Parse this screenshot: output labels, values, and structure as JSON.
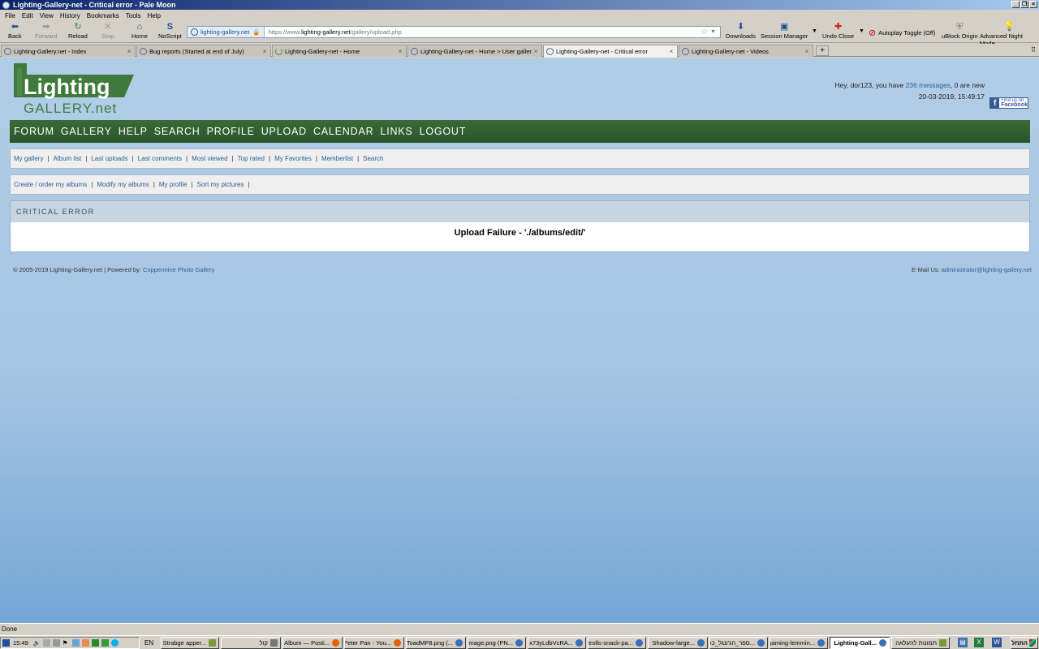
{
  "window": {
    "title": "Lighting-Gallery-net - Critical error - Pale Moon",
    "controls": [
      "_",
      "❐",
      "×"
    ]
  },
  "menu": [
    "File",
    "Edit",
    "View",
    "History",
    "Bookmarks",
    "Tools",
    "Help"
  ],
  "toolbar": {
    "back": "Back",
    "forward": "Forward",
    "reload": "Reload",
    "stop": "Stop",
    "home": "Home",
    "noscript": "NoScript",
    "site_identity": "lighting-gallery.net",
    "url_prefix": "https://www.",
    "url_domain": "lighting-gallery.net",
    "url_path": "/gallery/upload.php",
    "downloads": "Downloads",
    "session_manager": "Session Manager",
    "undo_close": "Undo Close",
    "autoplay_toggle": "Autoplay Toggle (Off)",
    "ublock": "uBlock Origin",
    "night_mode": "Advanced Night Mode"
  },
  "tabs": [
    {
      "label": "Lighting-Gallery.net - Index",
      "active": false
    },
    {
      "label": "Bug reports (Started at end of July)",
      "active": false
    },
    {
      "label": "Lighting-Gallery-net - Home",
      "active": false
    },
    {
      "label": "Lighting-Gallery-net - Home > User galler…",
      "active": false
    },
    {
      "label": "Lighting-Gallery-net - Critical error",
      "active": true
    },
    {
      "label": "Lighting-Gallery-net - Videos",
      "active": false
    }
  ],
  "header": {
    "logo_top": "Lighting",
    "logo_bottom": "GALLERY.net",
    "greeting_prefix": "Hey, dor123, you have ",
    "messages_link": "236 messages",
    "greeting_suffix": ", 0 are new",
    "datetime": "20-03-2019, 15:49:17",
    "facebook_small": "Find us on",
    "facebook_big": "Facebook"
  },
  "main_nav": [
    "FORUM",
    "GALLERY",
    "HELP",
    "SEARCH",
    "PROFILE",
    "UPLOAD",
    "CALENDAR",
    "LINKS",
    "LOGOUT"
  ],
  "sub_nav_1": [
    "My gallery",
    "Album list",
    "Last uploads",
    "Last comments",
    "Most viewed",
    "Top rated",
    "My Favorites",
    "Memberlist",
    "Search"
  ],
  "sub_nav_2": [
    "Create / order my albums",
    "Modify my albums",
    "My profile",
    "Sort my pictures"
  ],
  "error": {
    "heading": "CRITICAL ERROR",
    "message": "Upload Failure - './albums/edit/'"
  },
  "footer": {
    "copyright": "© 2005-2019 Lighting-Gallery.net | Powered by: ",
    "powered_link": "Coppermine Photo Gallery",
    "email_label": "E-Mail Us: ",
    "email_link": "administrator@lighting-gallery.net"
  },
  "status": "Done",
  "taskbar": {
    "clock": "15:49",
    "lang": "EN",
    "start": "התחל",
    "tasks": [
      {
        "label": "Strabge apper...",
        "icon": "img"
      },
      {
        "label": "קול",
        "icon": "spk"
      },
      {
        "label": "Album — Posti...",
        "icon": "ff"
      },
      {
        "label": "Peter Pan - You...",
        "icon": "ff"
      },
      {
        "label": "ToadMP8.png (...",
        "icon": "ie"
      },
      {
        "label": "image.png (PN...",
        "icon": "ie"
      },
      {
        "label": "x73yLdbVcRA...",
        "icon": "ie"
      },
      {
        "label": "trolls-snack-pa...",
        "icon": "ie"
      },
      {
        "label": "Shadow-large...",
        "icon": "ie"
      },
      {
        "label": "ספר_הג'ונגל_כר...",
        "icon": "ie"
      },
      {
        "label": "gaming-lemmin...",
        "icon": "ie"
      },
      {
        "label": "Lighting-Gall...",
        "icon": "ie",
        "active": true
      },
      {
        "label": "תמונות להעלאה",
        "icon": "img"
      }
    ]
  },
  "colors": {
    "nav_green": "#2f5e2e",
    "link_blue": "#2a5e95",
    "panel_head": "#c7d5e2",
    "background_top": "#b1cde6",
    "background_bottom": "#74a6d6"
  }
}
